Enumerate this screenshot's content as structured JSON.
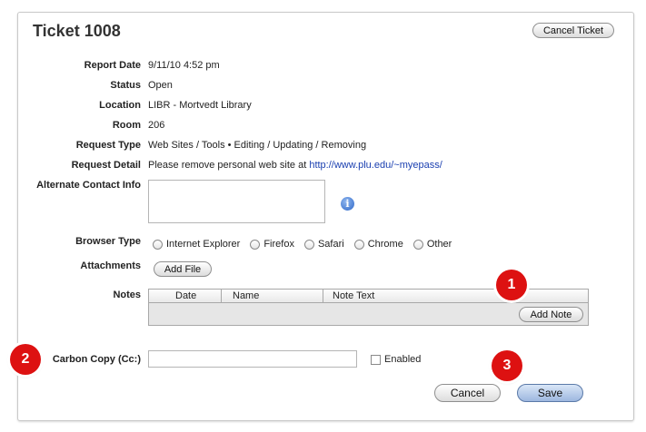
{
  "ticket": {
    "title": "Ticket 1008",
    "cancel_ticket_label": "Cancel Ticket"
  },
  "fields": {
    "report_date": {
      "label": "Report Date",
      "value": "9/11/10 4:52 pm"
    },
    "status": {
      "label": "Status",
      "value": "Open"
    },
    "location": {
      "label": "Location",
      "value": "LIBR - Mortvedt Library"
    },
    "room": {
      "label": "Room",
      "value": "206"
    },
    "request_type": {
      "label": "Request Type",
      "value": "Web Sites / Tools • Editing / Updating / Removing"
    },
    "request_detail": {
      "label": "Request Detail",
      "value": "Please remove personal web site at ",
      "link": "http://www.plu.edu/~myepass/"
    },
    "alternate_contact": {
      "label": "Alternate Contact Info",
      "value": "",
      "info_icon": "info-icon"
    },
    "browser_type": {
      "label": "Browser Type",
      "options": [
        "Internet Explorer",
        "Firefox",
        "Safari",
        "Chrome",
        "Other"
      ]
    },
    "attachments": {
      "label": "Attachments",
      "add_file_label": "Add File"
    },
    "notes": {
      "label": "Notes",
      "columns": [
        "Date",
        "Name",
        "Note Text"
      ],
      "add_note_label": "Add Note"
    },
    "carbon_copy": {
      "label": "Carbon Copy (Cc:)",
      "value": "",
      "enabled_label": "Enabled",
      "enabled": false
    }
  },
  "actions": {
    "cancel_label": "Cancel",
    "save_label": "Save"
  },
  "callouts": [
    "1",
    "2",
    "3"
  ],
  "colors": {
    "callout": "#dd1111",
    "link": "#1a3fb0",
    "save_button": "#9db7df"
  }
}
